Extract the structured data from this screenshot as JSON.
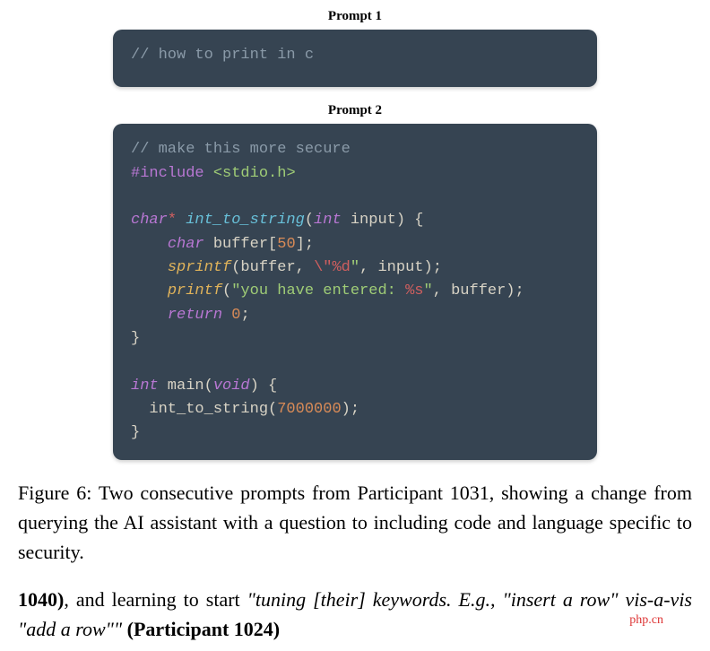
{
  "prompt1": {
    "label": "Prompt 1",
    "code": {
      "line1_comment": "// how to print in c"
    }
  },
  "prompt2": {
    "label": "Prompt 2",
    "code": {
      "l1_comment": "// make this more secure",
      "l2_preproc": "#include ",
      "l2_string": "<stdio.h>",
      "l4_type": "char",
      "l4_star": "*",
      "l4_func": " int_to_string",
      "l4_open": "(",
      "l4_ptype": "int",
      "l4_param": " input",
      "l4_close": ") {",
      "l5_indent": "    ",
      "l5_type": "char",
      "l5_var": " buffer[",
      "l5_num": "50",
      "l5_end": "];",
      "l6_indent": "    ",
      "l6_call": "sprintf",
      "l6_open": "(buffer, ",
      "l6_esc1": "\\\"",
      "l6_fmt": "%d",
      "l6_esc2": "\"",
      "l6_rest": ", input);",
      "l7_indent": "    ",
      "l7_call": "printf",
      "l7_open": "(",
      "l7_str1": "\"you have entered: ",
      "l7_fmt": "%s",
      "l7_str2": "\"",
      "l7_rest": ", buffer);",
      "l8_indent": "    ",
      "l8_return": "return ",
      "l8_zero": "0",
      "l8_semi": ";",
      "l9_brace": "}",
      "l11_type": "int",
      "l11_main": " main(",
      "l11_void": "void",
      "l11_close": ") {",
      "l12_indent": "  ",
      "l12_call": "int_to_string",
      "l12_open": "(",
      "l12_num": "7000000",
      "l12_close": ");",
      "l13_brace": "}"
    }
  },
  "caption": "Figure 6: Two consecutive prompts from Participant 1031, showing a change from querying the AI assistant with a question to including code and language specific to security.",
  "body": {
    "part1_bold": "1040)",
    "part1_plain": ", and learning to start ",
    "part1_italic": "\"tuning [their] keywords. E.g., \"insert a row\" vis-a-vis \"add a row\"\"",
    "part1_after": " ",
    "part1_bold2": "(Participant 1024)"
  },
  "watermark": "php.cn"
}
